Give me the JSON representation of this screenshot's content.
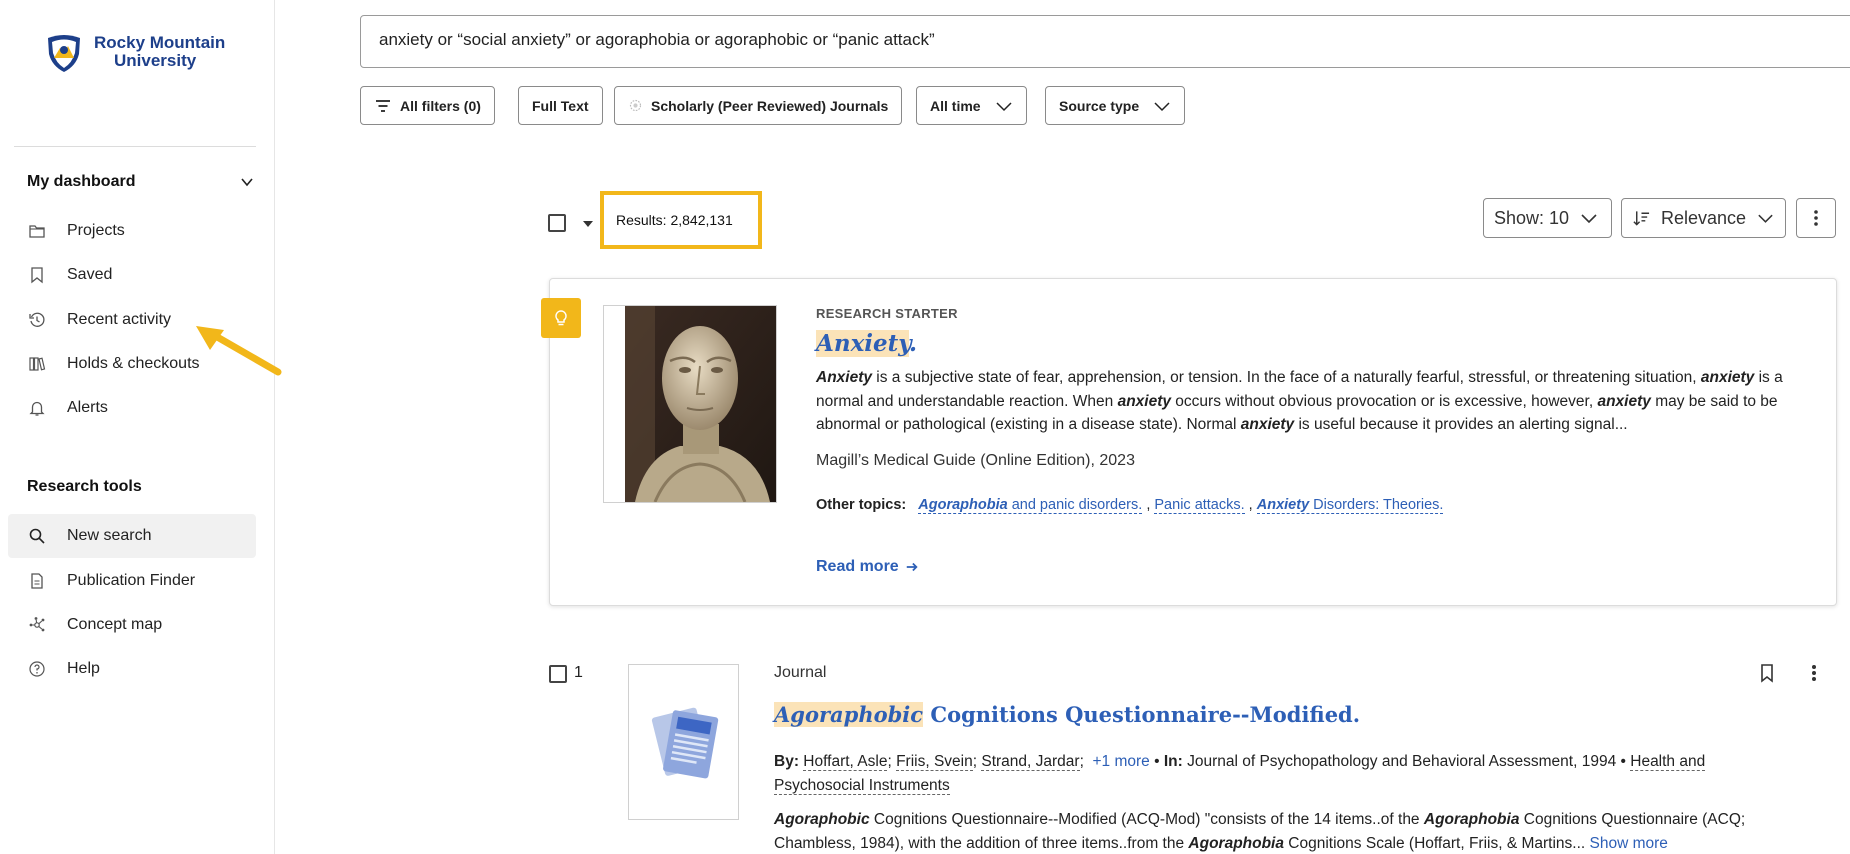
{
  "sidebar": {
    "logo": {
      "line1": "Rocky Mountain",
      "line2": "University"
    },
    "dashboard_heading": "My dashboard",
    "dashboard_items": [
      {
        "label": "Projects",
        "icon": "folder-icon"
      },
      {
        "label": "Saved",
        "icon": "bookmark-icon"
      },
      {
        "label": "Recent activity",
        "icon": "history-icon"
      },
      {
        "label": "Holds & checkouts",
        "icon": "books-icon"
      },
      {
        "label": "Alerts",
        "icon": "bell-icon"
      }
    ],
    "tools_heading": "Research tools",
    "tools_items": [
      {
        "label": "New search",
        "icon": "search-icon",
        "active": true
      },
      {
        "label": "Publication Finder",
        "icon": "document-icon"
      },
      {
        "label": "Concept map",
        "icon": "concept-map-icon"
      },
      {
        "label": "Help",
        "icon": "help-icon"
      }
    ]
  },
  "search": {
    "query": "anxiety or “social anxiety” or agoraphobia or agoraphobic or “panic attack”"
  },
  "filters": {
    "all_filters": "All filters (0)",
    "full_text": "Full Text",
    "peer_reviewed": "Scholarly (Peer Reviewed) Journals",
    "all_time": "All time",
    "source_type": "Source type"
  },
  "results": {
    "count_label": "Results: 2,842,131",
    "show": "Show: 10",
    "sort": "Relevance"
  },
  "research_starter": {
    "label": "RESEARCH STARTER",
    "title": "Anxiety",
    "title_suffix": ".",
    "abstract": [
      {
        "t": "Anxiety",
        "b": true
      },
      {
        "t": " is a subjective state of fear, apprehension, or tension. In the face of a naturally fearful, stressful, or threatening situation, "
      },
      {
        "t": "anxiety",
        "b": true
      },
      {
        "t": " is a normal and understandable reaction. When "
      },
      {
        "t": "anxiety",
        "b": true
      },
      {
        "t": " occurs without obvious provocation or is excessive, however, "
      },
      {
        "t": "anxiety",
        "b": true
      },
      {
        "t": " may be said to be abnormal or pathological (existing in a disease state). Normal "
      },
      {
        "t": "anxiety",
        "b": true
      },
      {
        "t": " is useful because it provides an alerting signal..."
      }
    ],
    "source": "Magill’s Medical Guide (Online Edition), 2023",
    "other_topics_label": "Other topics:",
    "topics": [
      {
        "em": "Agoraphobia",
        "rest": " and panic disorders."
      },
      {
        "em": "",
        "rest": "Panic attacks."
      },
      {
        "em": "Anxiety",
        "rest": " Disorders: Theories."
      }
    ],
    "read_more": "Read more"
  },
  "result_1": {
    "number": "1",
    "type": "Journal",
    "title_hl": "Agoraphobic",
    "title_rest": " Cognitions Questionnaire--Modified.",
    "by_label": "By:",
    "authors": [
      "Hoffart, Asle",
      "Friis, Svein",
      "Strand, Jardar"
    ],
    "more_authors": "+1 more",
    "in_label": "In:",
    "in_source": "Journal of Psychopathology and Behavioral Assessment, 1994",
    "subject": "Health and Psychosocial Instruments",
    "abstract": [
      {
        "t": "Agoraphobic",
        "b": true
      },
      {
        "t": " Cognitions Questionnaire--Modified (ACQ-Mod) \"consists of the 14 items..of the "
      },
      {
        "t": "Agoraphobia",
        "b": true
      },
      {
        "t": " Cognitions Questionnaire (ACQ; Chambless, 1984), with the addition of three items..from the "
      },
      {
        "t": "Agoraphobia",
        "b": true
      },
      {
        "t": " Cognitions Scale (Hoffart, Friis, & Martins... "
      }
    ],
    "show_more": "Show more"
  },
  "colors": {
    "accent": "#2d5fb6",
    "highlight": "#f2b71a",
    "hl_bg": "#fbe3b8"
  }
}
